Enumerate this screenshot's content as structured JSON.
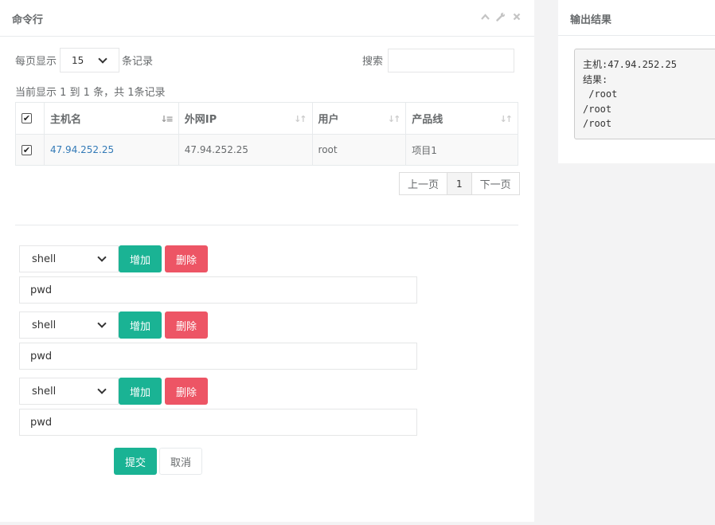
{
  "left_panel": {
    "title": "命令行",
    "tools": {
      "collapse_icon": "chevron-up-icon",
      "config_icon": "wrench-icon",
      "close_icon": "close-icon"
    }
  },
  "table_controls": {
    "per_page_label": "每页显示",
    "per_page_value": "15",
    "records_label": "条记录",
    "search_label": "搜索",
    "search_value": "",
    "info": "当前显示 1 到 1 条，共 1条记录"
  },
  "table": {
    "columns": [
      "主机名",
      "外网IP",
      "用户",
      "产品线"
    ],
    "rows": [
      {
        "checked": true,
        "host": "47.94.252.25",
        "ip": "47.94.252.25",
        "user": "root",
        "product": "项目1"
      }
    ]
  },
  "pagination": {
    "prev": "上一页",
    "current": "1",
    "next": "下一页"
  },
  "commands": [
    {
      "type": "shell",
      "add_label": "增加",
      "delete_label": "删除",
      "command": "pwd"
    },
    {
      "type": "shell",
      "add_label": "增加",
      "delete_label": "删除",
      "command": "pwd"
    },
    {
      "type": "shell",
      "add_label": "增加",
      "delete_label": "删除",
      "command": "pwd"
    }
  ],
  "form_actions": {
    "submit": "提交",
    "cancel": "取消"
  },
  "right_panel": {
    "title": "输出结果",
    "output": "主机:47.94.252.25\n结果:\n /root\n/root\n/root"
  },
  "colors": {
    "primary": "#1ab394",
    "danger": "#ed5565",
    "link": "#337ab7"
  }
}
